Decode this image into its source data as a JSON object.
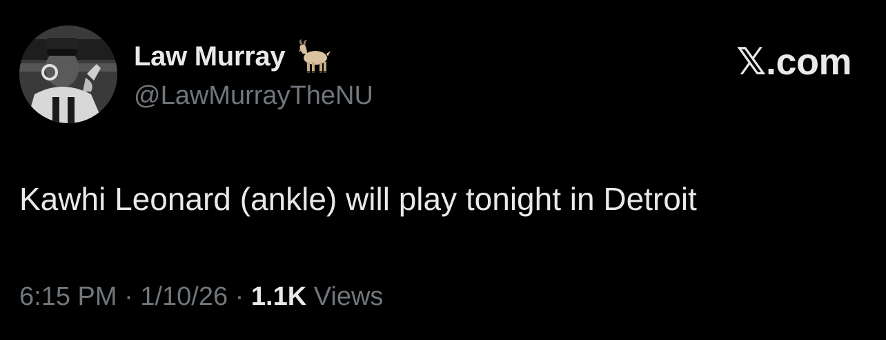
{
  "author": {
    "display_name": "Law Murray",
    "name_emoji": "goat-icon",
    "handle": "@LawMurrayTheNU",
    "avatar": "avatar"
  },
  "brand": {
    "label": "𝕏.com"
  },
  "tweet": {
    "text": "Kawhi Leonard (ankle) will play tonight in Detroit"
  },
  "meta": {
    "time": "6:15 PM",
    "separator": " · ",
    "date": "1/10/26",
    "views_count": "1.1K",
    "views_label": " Views"
  },
  "colors": {
    "background": "#000000",
    "primary_text": "#e7e9ea",
    "secondary_text": "#71767b"
  }
}
